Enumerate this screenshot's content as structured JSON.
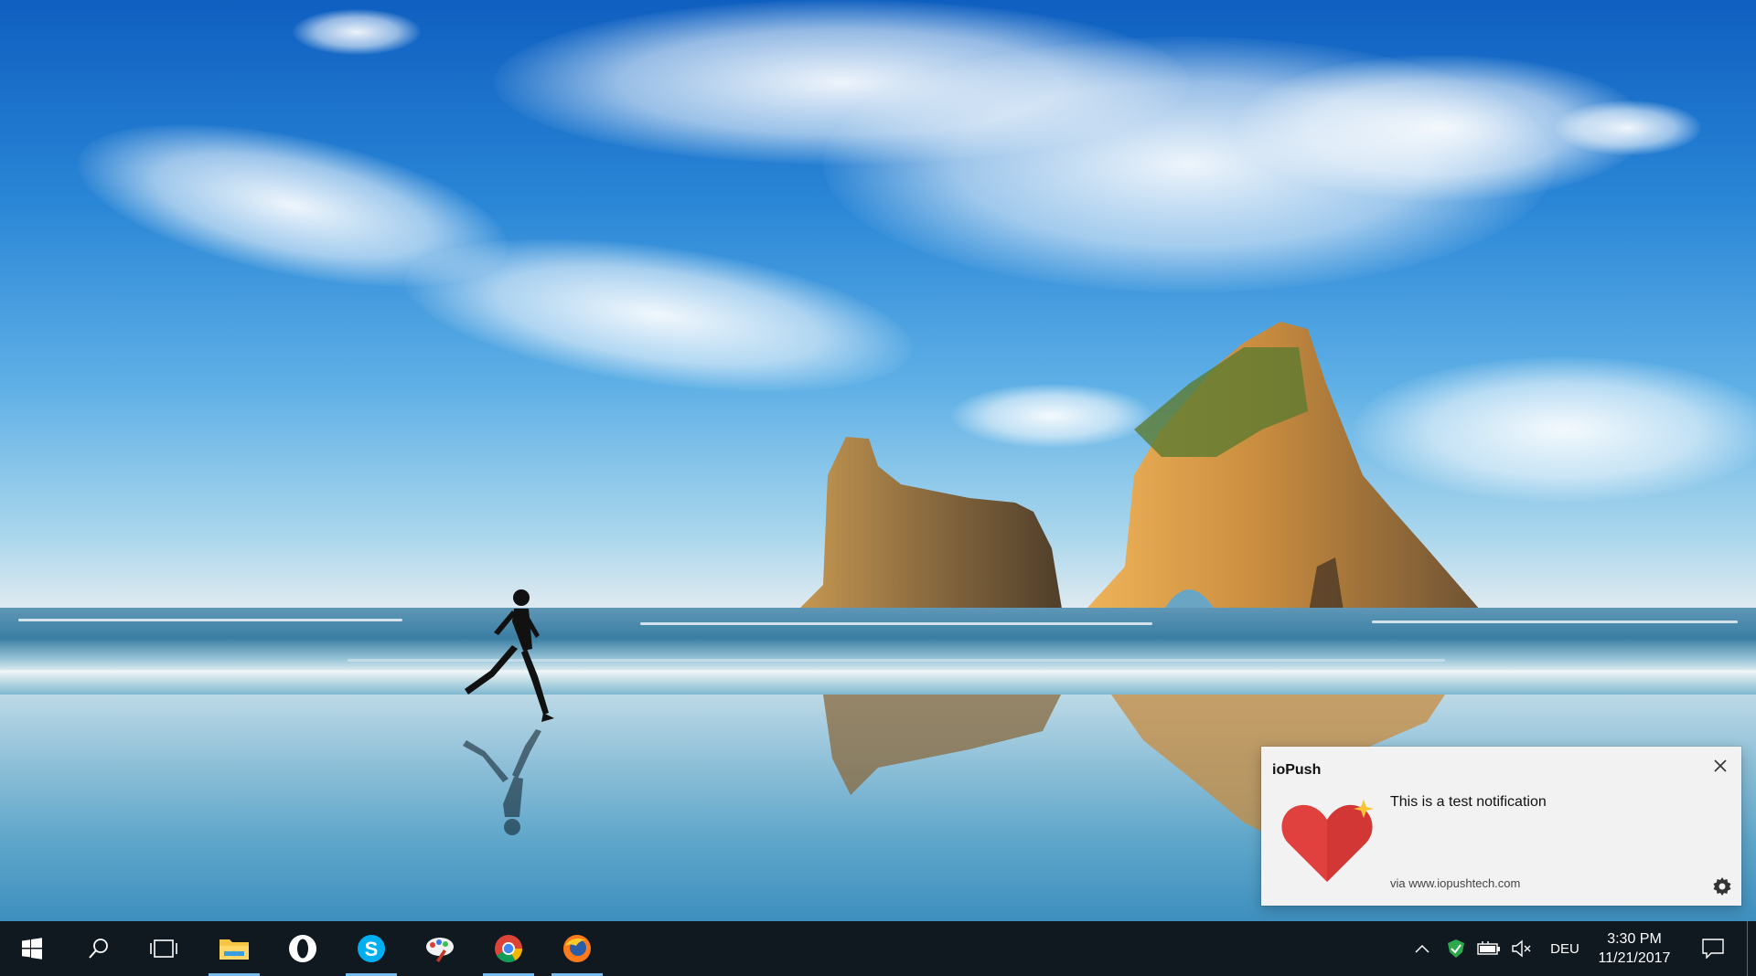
{
  "notification": {
    "app_name": "ioPush",
    "message": "This is a test notification",
    "attribution": "via www.iopushtech.com",
    "close_icon": "close-icon",
    "settings_icon": "gear-icon",
    "image_icon": "heart-icon",
    "heart_color": "#e0413f"
  },
  "taskbar": {
    "start_icon": "windows-logo-icon",
    "search_icon": "search-icon",
    "task_view_icon": "task-view-icon",
    "pinned_apps": [
      {
        "name": "file-explorer",
        "icon": "folder-icon",
        "running": true
      },
      {
        "name": "opera",
        "icon": "opera-icon",
        "running": false
      },
      {
        "name": "skype",
        "icon": "skype-icon",
        "running": true
      },
      {
        "name": "paint",
        "icon": "paint-icon",
        "running": false
      },
      {
        "name": "chrome",
        "icon": "chrome-icon",
        "running": true
      },
      {
        "name": "firefox",
        "icon": "firefox-icon",
        "running": true
      }
    ],
    "tray": {
      "overflow_icon": "chevron-up-icon",
      "security_icon": "shield-check-icon",
      "battery_icon": "battery-icon",
      "volume_icon": "volume-muted-icon",
      "language": "DEU",
      "time": "3:30 PM",
      "date": "11/21/2017",
      "action_center_icon": "action-center-icon"
    },
    "accent_color": "#76b9ed"
  }
}
